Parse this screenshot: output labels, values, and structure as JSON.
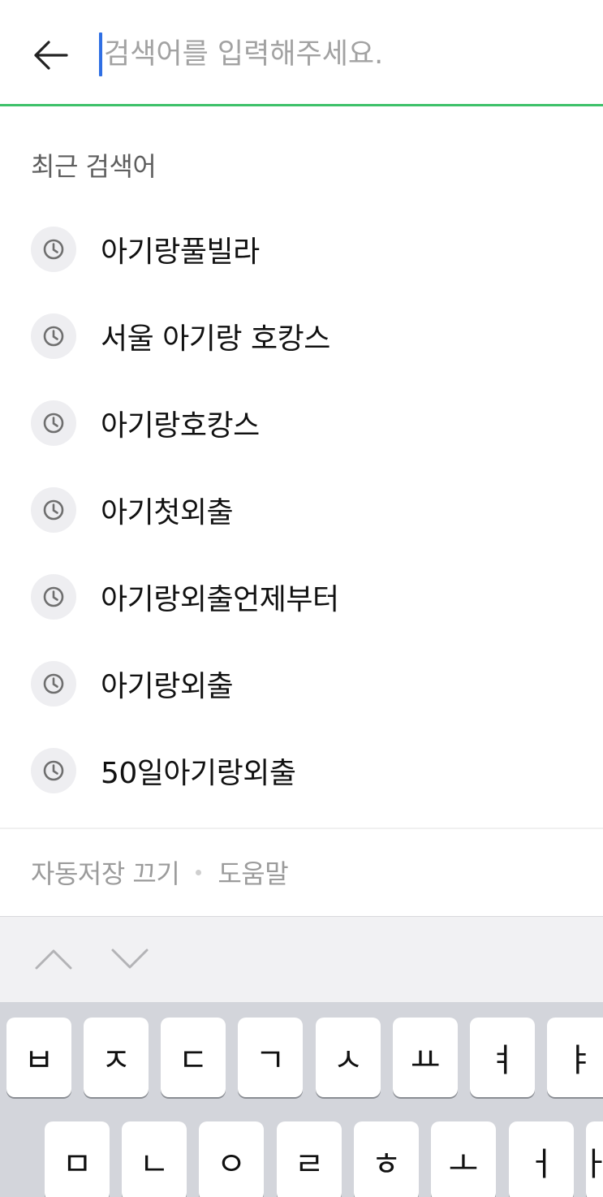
{
  "search": {
    "placeholder": "검색어를 입력해주세요.",
    "value": "",
    "accent_color": "#3ec16a",
    "caret_color": "#2f6fe4"
  },
  "back_icon": "arrow-left-icon",
  "recent": {
    "title": "최근 검색어",
    "items": [
      {
        "label": "아기랑풀빌라",
        "icon": "clock-icon"
      },
      {
        "label": "서울 아기랑 호캉스",
        "icon": "clock-icon"
      },
      {
        "label": "아기랑호캉스",
        "icon": "clock-icon"
      },
      {
        "label": "아기첫외출",
        "icon": "clock-icon"
      },
      {
        "label": "아기랑외출언제부터",
        "icon": "clock-icon"
      },
      {
        "label": "아기랑외출",
        "icon": "clock-icon"
      },
      {
        "label": "50일아기랑외출",
        "icon": "clock-icon"
      }
    ]
  },
  "footer": {
    "autosave_off": "자동저장 끄기",
    "help": "도움말"
  },
  "keyboard": {
    "accessory": {
      "prev_icon": "chevron-up-icon",
      "next_icon": "chevron-down-icon"
    },
    "row1": [
      "ㅂ",
      "ㅈ",
      "ㄷ",
      "ㄱ",
      "ㅅ",
      "ㅛ",
      "ㅕ",
      "ㅑ"
    ],
    "row2": [
      "ㅁ",
      "ㄴ",
      "ㅇ",
      "ㄹ",
      "ㅎ",
      "ㅗ",
      "ㅓ",
      "ㅏ"
    ]
  }
}
